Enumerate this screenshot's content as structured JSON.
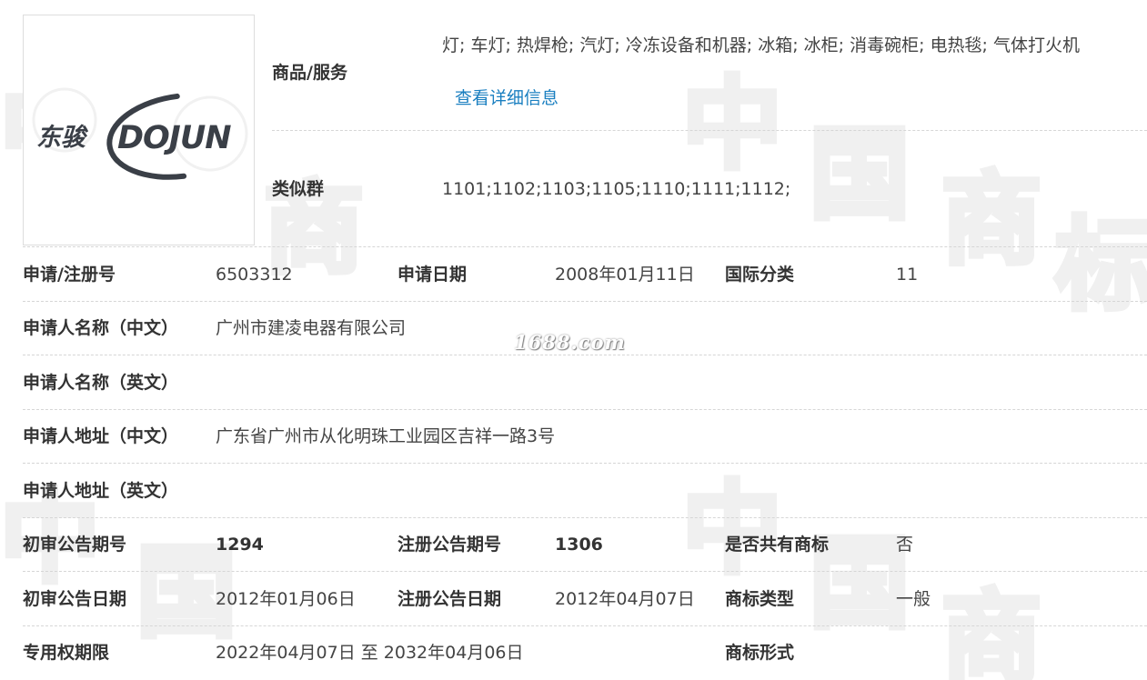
{
  "logo": {
    "chinese_text": "东骏",
    "english_text": "DOJUN"
  },
  "top": {
    "goods_label": "商品/服务",
    "goods_value": "灯; 车灯; 热焊枪; 汽灯; 冷冻设备和机器; 冰箱; 冰柜; 消毒碗柜; 电热毯; 气体打火机",
    "detail_link": "查看详细信息",
    "similar_label": "类似群",
    "similar_value": "1101;1102;1103;1105;1110;1111;1112;"
  },
  "rows": {
    "reg_no_label": "申请/注册号",
    "reg_no_value": "6503312",
    "apply_date_label": "申请日期",
    "apply_date_value": "2008年01月11日",
    "intl_class_label": "国际分类",
    "intl_class_value": "11",
    "applicant_cn_label": "申请人名称（中文）",
    "applicant_cn_value": "广州市建凌电器有限公司",
    "applicant_en_label": "申请人名称（英文）",
    "address_cn_label": "申请人地址（中文）",
    "address_cn_value": "广东省广州市从化明珠工业园区吉祥一路3号",
    "address_en_label": "申请人地址（英文）",
    "prelim_no_label": "初审公告期号",
    "prelim_no_value": "1294",
    "reg_pub_no_label": "注册公告期号",
    "reg_pub_no_value": "1306",
    "shared_label": "是否共有商标",
    "shared_value": "否",
    "prelim_date_label": "初审公告日期",
    "prelim_date_value": "2012年01月06日",
    "reg_pub_date_label": "注册公告日期",
    "reg_pub_date_value": "2012年04月07日",
    "type_label": "商标类型",
    "type_value": "一般",
    "term_label": "专用权期限",
    "term_value": "2022年04月07日 至 2032年04月06日",
    "form_label": "商标形式"
  },
  "watermark": {
    "site": "1688.com",
    "chars": [
      "中",
      "国",
      "商",
      "标"
    ]
  },
  "colors": {
    "link": "#1a7fc0",
    "label": "#333333",
    "divider": "#d6d6d6",
    "watermark": "#f0f0f0"
  }
}
